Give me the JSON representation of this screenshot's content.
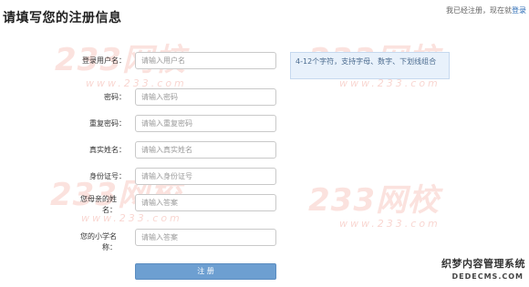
{
  "header": {
    "title": "请填写您的注册信息",
    "already_registered": "我已经注册，现在就",
    "login_link": "登录"
  },
  "watermark": {
    "brand": "233网校",
    "url": "www.233.com"
  },
  "form": {
    "fields": [
      {
        "label": "登录用户名：",
        "placeholder": "请输入用户名"
      },
      {
        "label": "密码：",
        "placeholder": "请输入密码"
      },
      {
        "label": "重复密码：",
        "placeholder": "请输入重复密码"
      },
      {
        "label": "真实姓名：",
        "placeholder": "请输入真实姓名"
      },
      {
        "label": "身份证号：",
        "placeholder": "请输入身份证号"
      },
      {
        "label": "您母亲的姓名：",
        "placeholder": "请输入答案"
      },
      {
        "label": "您的小学名称：",
        "placeholder": "请输入答案"
      }
    ],
    "username_hint": "4-12个字符，支持字母、数字、下划线组合",
    "submit_label": "注 册"
  },
  "corner_logo": {
    "name": "织梦内容管理系统",
    "domain": "DEDECMS.COM"
  },
  "colors": {
    "watermark": "#e85c48",
    "button": "#6d9fd1",
    "link": "#2b6bb5",
    "hint_bg": "#e8f1fb"
  }
}
